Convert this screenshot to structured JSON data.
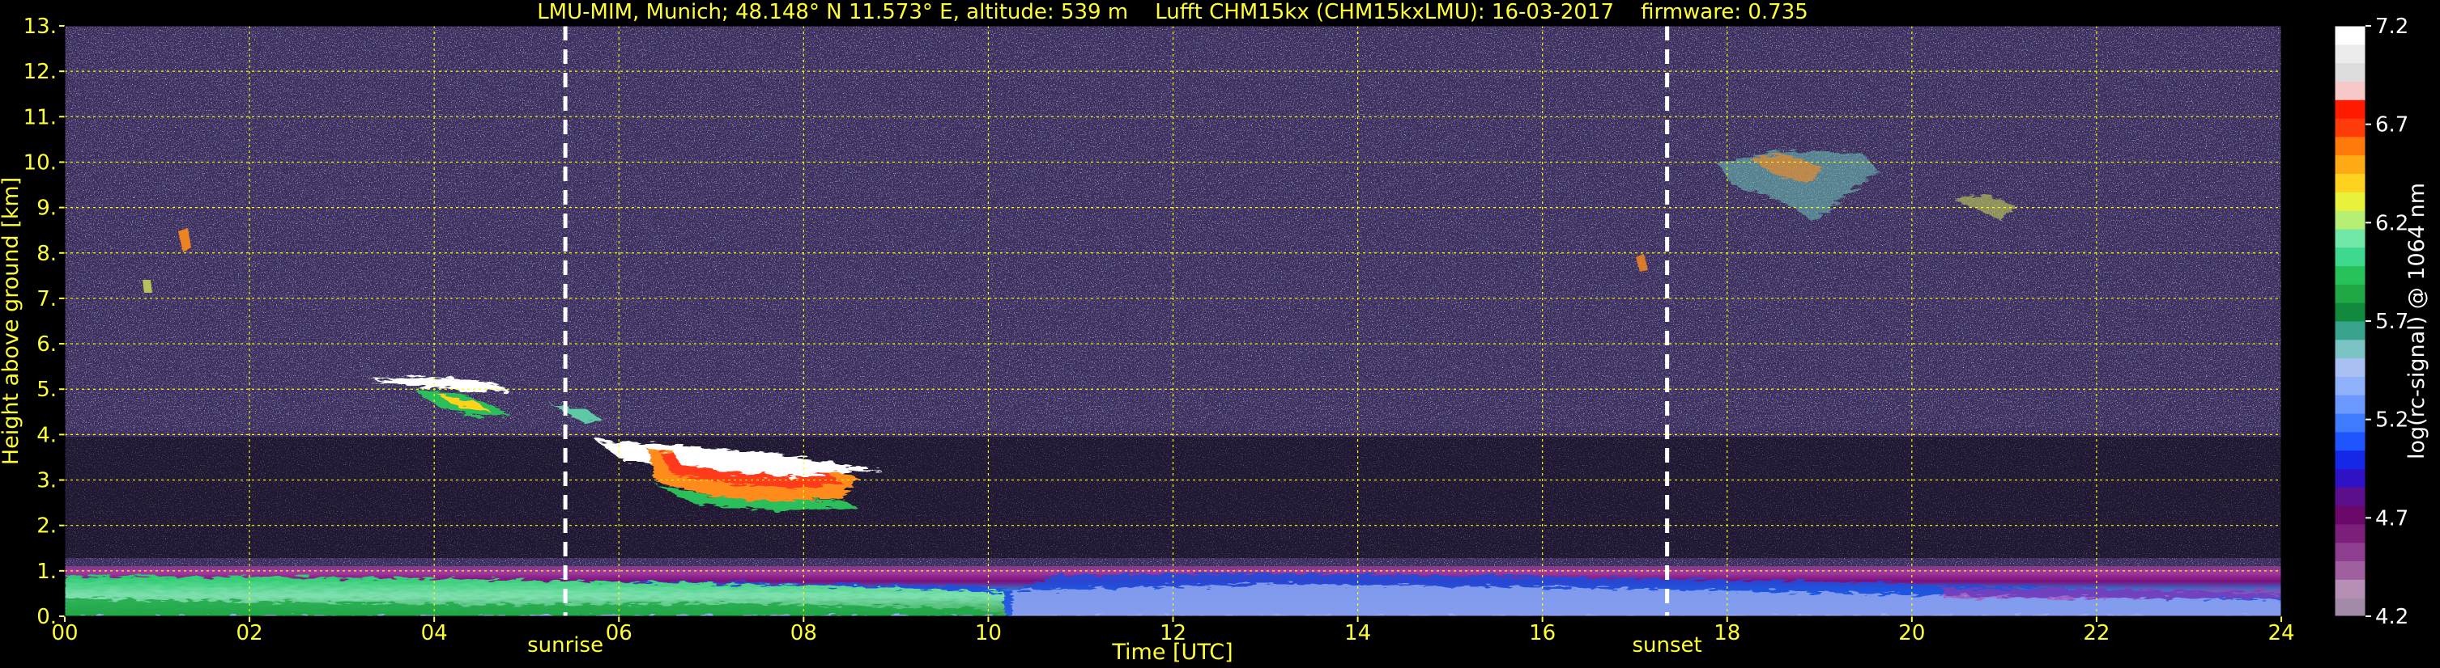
{
  "chart_data": {
    "type": "heatmap",
    "title": "LMU-MIM, Munich; 48.148° N 11.573° E, altitude: 539 m    Lufft CHM15kx (CHM15kxLMU): 16-03-2017    firmware: 0.735",
    "xlabel": "Time [UTC]",
    "ylabel": "Height above ground [km]",
    "xlim": [
      0,
      24
    ],
    "ylim": [
      0,
      13
    ],
    "x_ticks": [
      "00",
      "02",
      "04",
      "06",
      "08",
      "10",
      "12",
      "14",
      "16",
      "18",
      "20",
      "22",
      "24"
    ],
    "y_ticks": [
      "0.",
      "1.",
      "2.",
      "3.",
      "4.",
      "5.",
      "6.",
      "7.",
      "8.",
      "9.",
      "10.",
      "11.",
      "12.",
      "13."
    ],
    "grid": true,
    "markers": [
      {
        "label": "sunrise",
        "x": 5.42
      },
      {
        "label": "sunset",
        "x": 17.35
      }
    ],
    "colorbar": {
      "label": "log(rc-signal) @ 1064 nm",
      "range": [
        4.2,
        7.2
      ],
      "ticks": [
        "4.2",
        "4.7",
        "5.2",
        "5.7",
        "6.2",
        "6.7",
        "7.2"
      ]
    },
    "features": [
      {
        "name": "boundary layer aerosol",
        "x_range": [
          0,
          24
        ],
        "height_km": [
          0,
          1.0
        ]
      },
      {
        "name": "mid-level cloud",
        "x_range": [
          3.3,
          5.0
        ],
        "height_km": [
          4.4,
          5.3
        ]
      },
      {
        "name": "mid-level cloud",
        "x_range": [
          6.0,
          9.2
        ],
        "height_km": [
          2.6,
          3.8
        ]
      },
      {
        "name": "cirrus",
        "x_range": [
          17.7,
          21.5
        ],
        "height_km": [
          8.5,
          10.3
        ]
      }
    ]
  },
  "colors": {
    "axis_text": "#ffff33",
    "colorbar_text": "#ffffff",
    "grid": "#ffff00",
    "background_noise": "#4a3b6e",
    "marker_line": "#ffffff"
  }
}
